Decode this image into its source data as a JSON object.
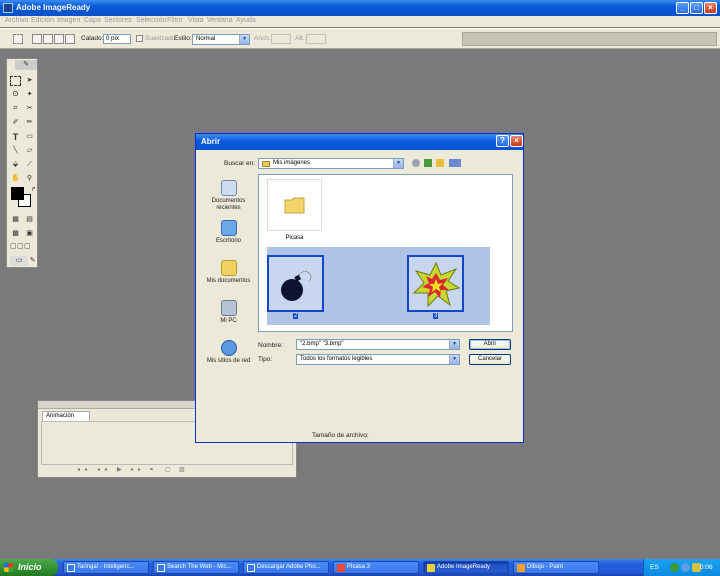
{
  "app": {
    "title": "Adobe ImageReady",
    "menu": [
      "Archivo",
      "Edición",
      "Imagen",
      "Capa",
      "Sectores",
      "Selección",
      "Filtro",
      "Vista",
      "Ventana",
      "Ayuda"
    ]
  },
  "options_bar": {
    "feather_label": "Calado:",
    "feather_value": "0 píx",
    "antialias_label": "Suavizado",
    "style_label": "Estilo:",
    "style_value": "Normal",
    "width_label": "Anch.:",
    "height_label": "Alt.:"
  },
  "animation_panel": {
    "tab": "Animación"
  },
  "dialog": {
    "title": "Abrir",
    "look_in_label": "Buscar en:",
    "look_in_value": "Mis imágenes",
    "places": [
      {
        "label": "Documentos recientes"
      },
      {
        "label": "Escritorio"
      },
      {
        "label": "Mis documentos"
      },
      {
        "label": "Mi PC"
      },
      {
        "label": "Mis sitios de red"
      }
    ],
    "files": [
      {
        "name": "Picasa"
      },
      {
        "name": "2"
      },
      {
        "name": "3"
      }
    ],
    "filename_label": "Nombre:",
    "filename_value": "\"2.bmp\" \"3.bmp\"",
    "filetype_label": "Tipo:",
    "filetype_value": "Todos los formatos legibles",
    "open_button": "Abrir",
    "cancel_button": "Cancelar",
    "filesize_label": "Tamaño de archivo:"
  },
  "taskbar": {
    "start": "Inicio",
    "tasks": [
      "Taringa! - Inteligenc...",
      "Search The Web - Mic...",
      "Descargar Adobe Pho...",
      "Picasa 3",
      "Adobe ImageReady",
      "Dibujo - Paint"
    ],
    "language": "ES",
    "time": "0:06"
  }
}
